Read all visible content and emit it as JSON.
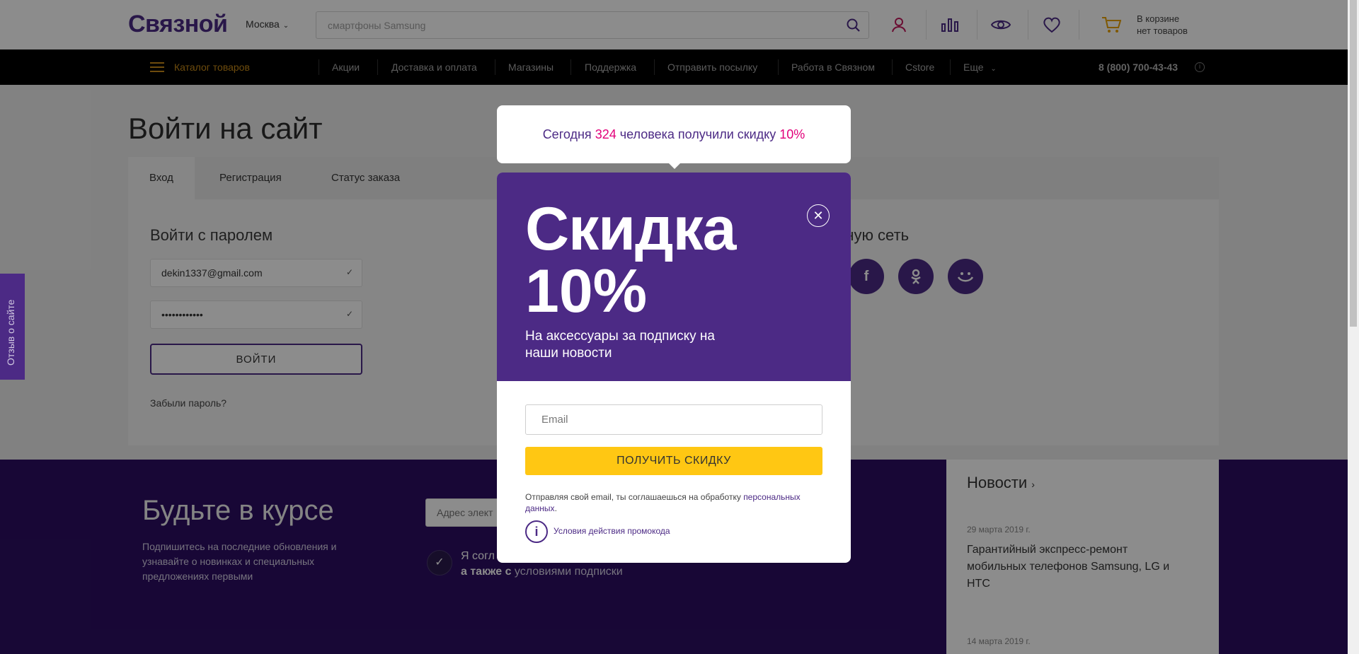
{
  "header": {
    "logo": "Связной",
    "city": "Москва",
    "search_placeholder": "смартфоны Samsung",
    "cart_line1": "В корзине",
    "cart_line2": "нет товаров"
  },
  "nav": {
    "catalog": "Каталог товаров",
    "items": [
      "Акции",
      "Доставка и оплата",
      "Магазины",
      "Поддержка",
      "Отправить посылку",
      "Работа в Связном",
      "Cstore",
      "Еще"
    ],
    "phone": "8 (800) 700-43-43"
  },
  "page": {
    "title": "Войти на сайт",
    "tabs": [
      "Вход",
      "Регистрация",
      "Статус заказа"
    ],
    "login_heading": "Войти с паролем",
    "email_value": "dekin1337@gmail.com",
    "password_value": "••••••••••••",
    "login_button": "ВОЙТИ",
    "forgot": "Забыли пароль?",
    "social_heading_partial": "льную сеть"
  },
  "side_tab": "Отзыв о сайте",
  "footer": {
    "title": "Будьте в курсе",
    "text": "Подпишитесь на последние обновления и узнавайте о новинках и специальных предложениях первыми",
    "email_placeholder": "Адрес элект",
    "agree_line1": "Я согл",
    "agree_line2_prefix": "а также с",
    "agree_line2_link": "условиями подписки"
  },
  "news": {
    "heading": "Новости",
    "item1_date": "29 марта 2019 г.",
    "item1_title": "Гарантийный экспресс-ремонт мобильных телефонов Samsung, LG и HTC",
    "item2_date": "14 марта 2019 г."
  },
  "popup": {
    "tooltip_prefix": "Сегодня",
    "tooltip_count": "324",
    "tooltip_middle": "человека получили скидку",
    "tooltip_percent": "10%",
    "big_line1": "Скидка",
    "big_line2": "10%",
    "subtitle": "На аксессуары за подписку на наши новости",
    "email_placeholder": "Email",
    "button": "ПОЛУЧИТЬ СКИДКУ",
    "legal_prefix": "Отправляя свой email, ты соглашаешься на обработку",
    "legal_link": "персональных данных",
    "legal_suffix": ".",
    "terms": "Условия действия промокода",
    "close": "✕"
  },
  "colors": {
    "brand": "#4c2a85",
    "accent_yellow": "#ffc713",
    "highlight": "#e2007a",
    "nav_bg": "#000000"
  }
}
